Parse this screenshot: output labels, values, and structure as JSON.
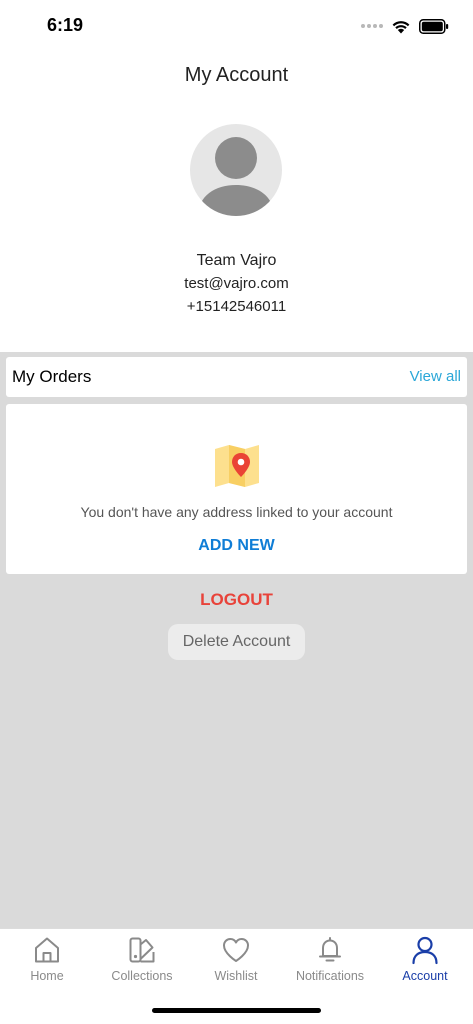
{
  "status_bar": {
    "time": "6:19"
  },
  "header": {
    "title": "My Account"
  },
  "profile": {
    "name": "Team Vajro",
    "email": "test@vajro.com",
    "phone": "+15142546011"
  },
  "orders": {
    "title": "My Orders",
    "view_all_label": "View all"
  },
  "address": {
    "empty_message": "You don't have any address linked to your account",
    "add_new_label": "ADD NEW"
  },
  "actions": {
    "logout_label": "LOGOUT",
    "delete_label": "Delete Account"
  },
  "tabs": [
    {
      "label": "Home",
      "icon": "home-icon",
      "active": false
    },
    {
      "label": "Collections",
      "icon": "collections-icon",
      "active": false
    },
    {
      "label": "Wishlist",
      "icon": "heart-icon",
      "active": false
    },
    {
      "label": "Notifications",
      "icon": "bell-icon",
      "active": false
    },
    {
      "label": "Account",
      "icon": "person-icon",
      "active": true
    }
  ],
  "colors": {
    "accent_blue": "#0f7dd6",
    "view_all": "#2aa7d8",
    "logout_red": "#e8433a",
    "active_tab": "#1a3ea8",
    "background": "#dadada"
  }
}
